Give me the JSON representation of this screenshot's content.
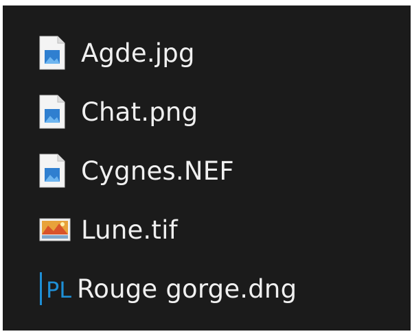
{
  "files": [
    {
      "name": "Agde.jpg",
      "icon": "image-file-icon"
    },
    {
      "name": "Chat.png",
      "icon": "image-file-icon"
    },
    {
      "name": "Cygnes.NEF",
      "icon": "image-file-icon"
    },
    {
      "name": "Lune.tif",
      "icon": "photo-viewer-icon"
    },
    {
      "name": "Rouge gorge.dng",
      "icon": "photolab-icon"
    }
  ],
  "photolab_icon_text": "PL",
  "colors": {
    "background": "#1b1b1b",
    "text": "#f0f0f0",
    "pl_accent": "#1e8fd6"
  }
}
